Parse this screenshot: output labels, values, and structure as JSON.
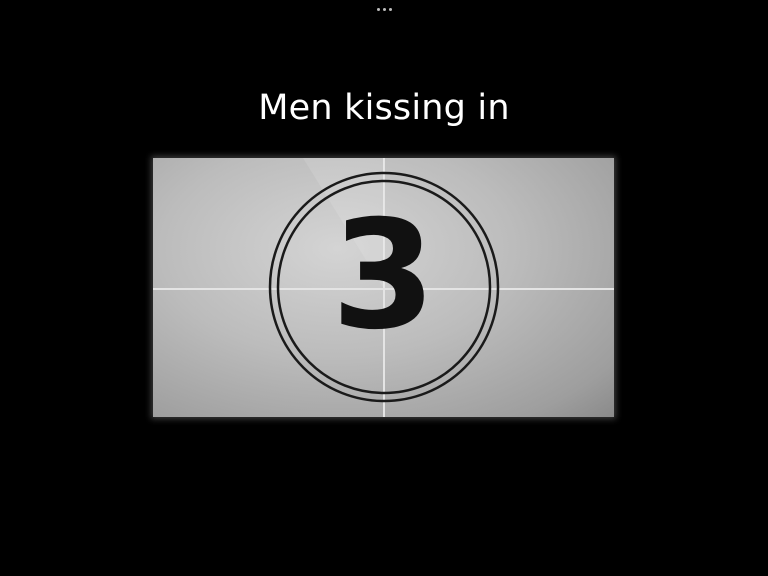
{
  "caption": "Men kissing in",
  "countdown": {
    "number": "3"
  },
  "menu": {
    "icon": "more-dots-icon"
  },
  "colors": {
    "background": "#000000",
    "caption_text": "#ffffff",
    "leader_frame": "#bcbcbc",
    "digit": "#111111"
  }
}
